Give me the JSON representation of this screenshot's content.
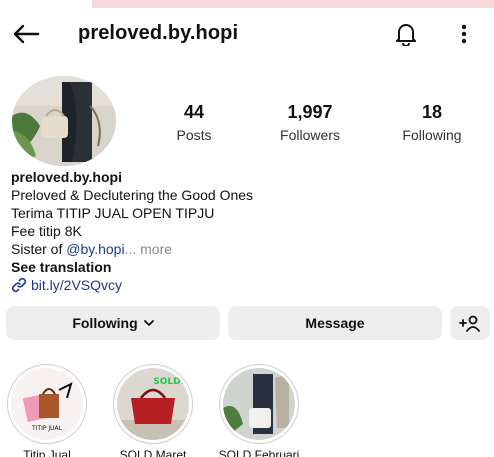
{
  "header": {
    "username": "preloved.by.hopi"
  },
  "stats": {
    "posts_count": "44",
    "posts_label": "Posts",
    "followers_count": "1,997",
    "followers_label": "Followers",
    "following_count": "18",
    "following_label": "Following"
  },
  "bio": {
    "name": "preloved.by.hopi",
    "line1": "Preloved & Declutering the Good Ones",
    "line2": "Terima TITIP JUAL OPEN TIPJU",
    "line3": "Fee titip 8K",
    "line4_prefix": "Sister of ",
    "line4_mention": "@by.hopi",
    "line4_more": "... more",
    "see_translation": "See translation",
    "link": "bit.ly/2VSQvcy"
  },
  "buttons": {
    "following": "Following",
    "message": "Message"
  },
  "highlights": [
    {
      "caption": "Titip Jual",
      "badge": "TITIP JUAL"
    },
    {
      "caption": "SOLD Maret",
      "badge": "SOLD!"
    },
    {
      "caption": "SOLD Februari"
    }
  ],
  "icons": {
    "back": "arrow-left-icon",
    "bell": "bell-icon",
    "more": "more-vertical-icon",
    "link": "link-icon",
    "chevron": "chevron-down-icon",
    "add_user": "add-user-icon"
  },
  "colors": {
    "mention": "#1f3a8a",
    "button_bg": "#ededed",
    "top_strip": "#f6d7dc"
  }
}
